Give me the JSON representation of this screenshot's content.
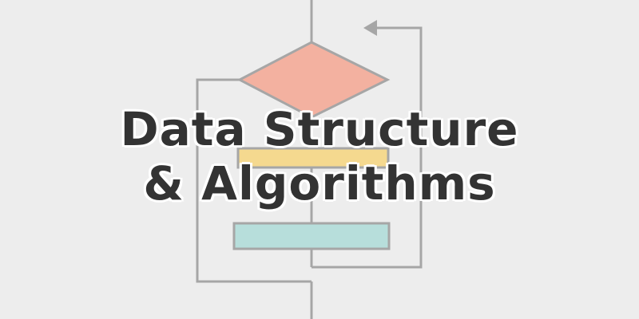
{
  "title": {
    "line1": "Data Structure",
    "line2": "& Algorithms"
  },
  "colors": {
    "background": "#ededed",
    "line": "#a6a6a6",
    "decision": "#f3b1a0",
    "process": "#f5d98f",
    "output": "#b7dedb",
    "text": "#333333"
  }
}
